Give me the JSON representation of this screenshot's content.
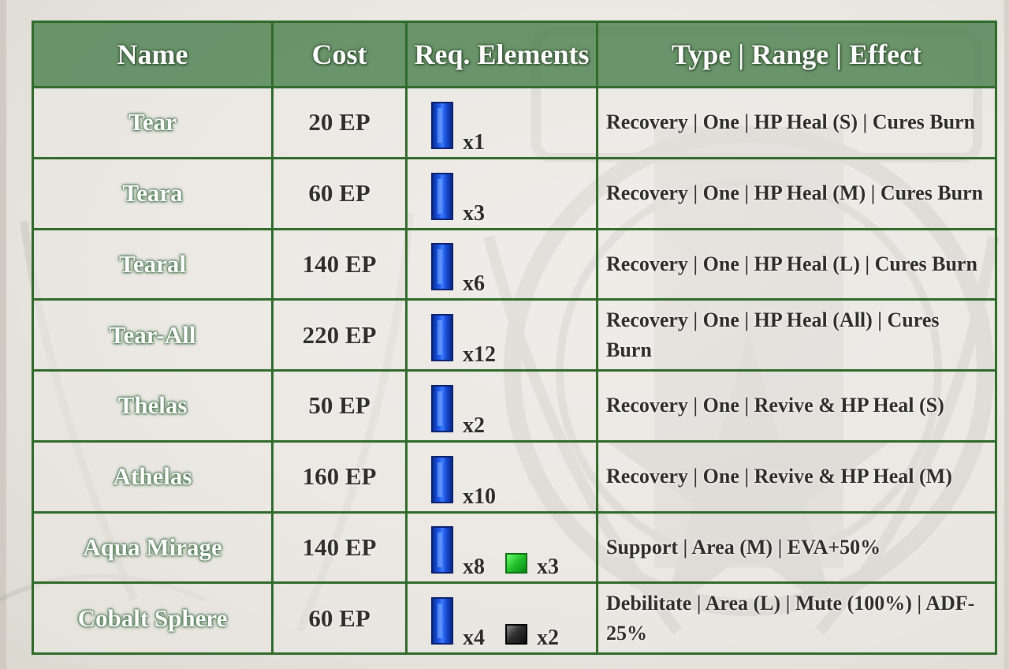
{
  "table": {
    "headers": {
      "name": "Name",
      "cost": "Cost",
      "elements": "Req. Elements",
      "effect": "Type | Range | Effect"
    },
    "rows": [
      {
        "name": "Tear",
        "cost": "20 EP",
        "water_count": "x1",
        "extra_icon": "",
        "extra_count": "",
        "effect": "Recovery | One | HP Heal (S) | Cures Burn"
      },
      {
        "name": "Teara",
        "cost": "60 EP",
        "water_count": "x3",
        "extra_icon": "",
        "extra_count": "",
        "effect": "Recovery | One | HP Heal (M) | Cures Burn"
      },
      {
        "name": "Tearal",
        "cost": "140 EP",
        "water_count": "x6",
        "extra_icon": "",
        "extra_count": "",
        "effect": "Recovery | One | HP Heal (L) | Cures Burn"
      },
      {
        "name": "Tear-All",
        "cost": "220 EP",
        "water_count": "x12",
        "extra_icon": "",
        "extra_count": "",
        "effect": "Recovery | One | HP Heal (All) | Cures Burn"
      },
      {
        "name": "Thelas",
        "cost": "50 EP",
        "water_count": "x2",
        "extra_icon": "",
        "extra_count": "",
        "effect": "Recovery | One | Revive & HP Heal (S)"
      },
      {
        "name": "Athelas",
        "cost": "160 EP",
        "water_count": "x10",
        "extra_icon": "",
        "extra_count": "",
        "effect": "Recovery | One | Revive & HP Heal (M)"
      },
      {
        "name": "Aqua Mirage",
        "cost": "140 EP",
        "water_count": "x8",
        "extra_icon": "green-wind-element-icon",
        "extra_count": "x3",
        "effect": "Support | Area (M) | EVA+50%"
      },
      {
        "name": "Cobalt Sphere",
        "cost": "60 EP",
        "water_count": "x4",
        "extra_icon": "black-space-element-icon",
        "extra_count": "x2",
        "effect": "Debilitate | Area (L) | Mute (100%) | ADF-25%"
      }
    ]
  },
  "icons": {
    "water": "blue-water-element-icon"
  },
  "colors": {
    "header_bg": "#5e8c60",
    "border": "#2f6a2a",
    "water_crystal": "#1f5cf0",
    "wind_gem": "#22c02a",
    "space_gem": "#303030"
  }
}
